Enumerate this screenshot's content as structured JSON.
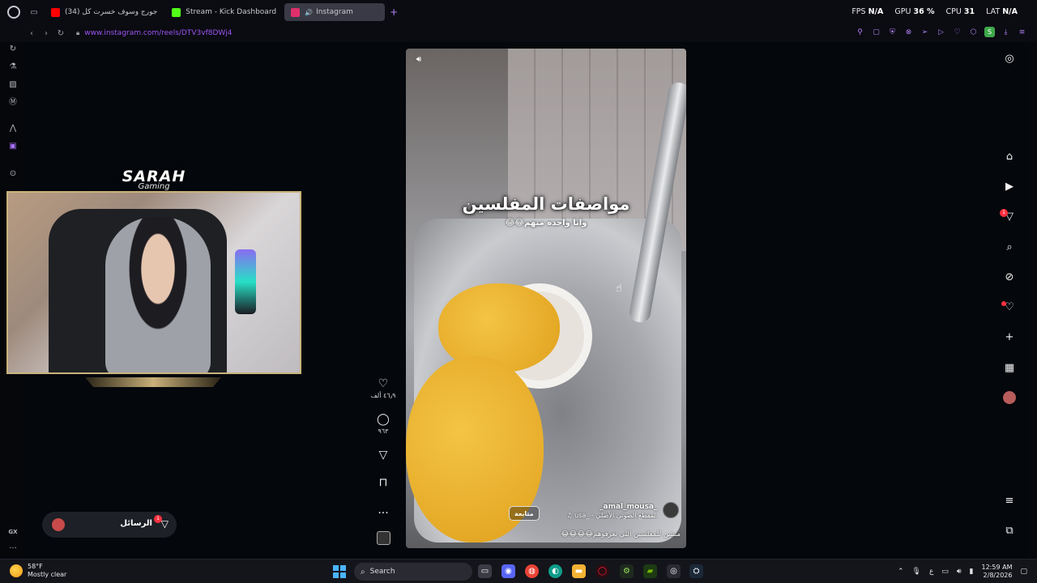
{
  "browser": {
    "tabs": [
      {
        "label": "(34) جورج وسوف خسرت كل",
        "fav_color": "#ff0000",
        "active": false
      },
      {
        "label": "Stream - Kick Dashboard",
        "fav_color": "#53fc18",
        "active": false
      },
      {
        "label": "Instagram",
        "fav_color": "#e1306c",
        "active": true
      }
    ],
    "new_tab": "+",
    "url": "www.instagram.com/reels/DTV3vf8DWj4",
    "hud": {
      "fps_label": "FPS",
      "fps": "N/A",
      "gpu_label": "GPU",
      "gpu": "36 %",
      "cpu_label": "CPU",
      "cpu": "31",
      "lat_label": "LAT",
      "lat": "N/A"
    },
    "profile_initial": "S",
    "sidebar_label": "GX",
    "sidebar_more": "..."
  },
  "overlay": {
    "logo_main": "SARAH",
    "logo_sub": "Gaming"
  },
  "reel": {
    "title": "مواصفات المفلسين",
    "subtitle": "وانا واحده منهم😂😂",
    "author": "_amal_mousa_",
    "audio": "المقطع الصوتي الأصلي - _usa ♫",
    "follow_label": "متابعة",
    "caption": "منشن للمفلسين اللي تعرفوهم😂😂😂😂",
    "likes": "٤٦٫٩ ألف",
    "comments": "٩٦٣",
    "more": "..."
  },
  "messages": {
    "label": "الرسائل",
    "badge": "1"
  },
  "ig_nav": {
    "notif_badge": "1"
  },
  "taskbar": {
    "temp": "58°F",
    "condition": "Mostly clear",
    "search_label": "Search",
    "time": "12:59 AM",
    "date": "2/8/2026",
    "lang": "ع"
  },
  "colors": {
    "accent": "#9a55f0",
    "badge": "#ff3040",
    "frame_gold": "#c8b37c"
  }
}
